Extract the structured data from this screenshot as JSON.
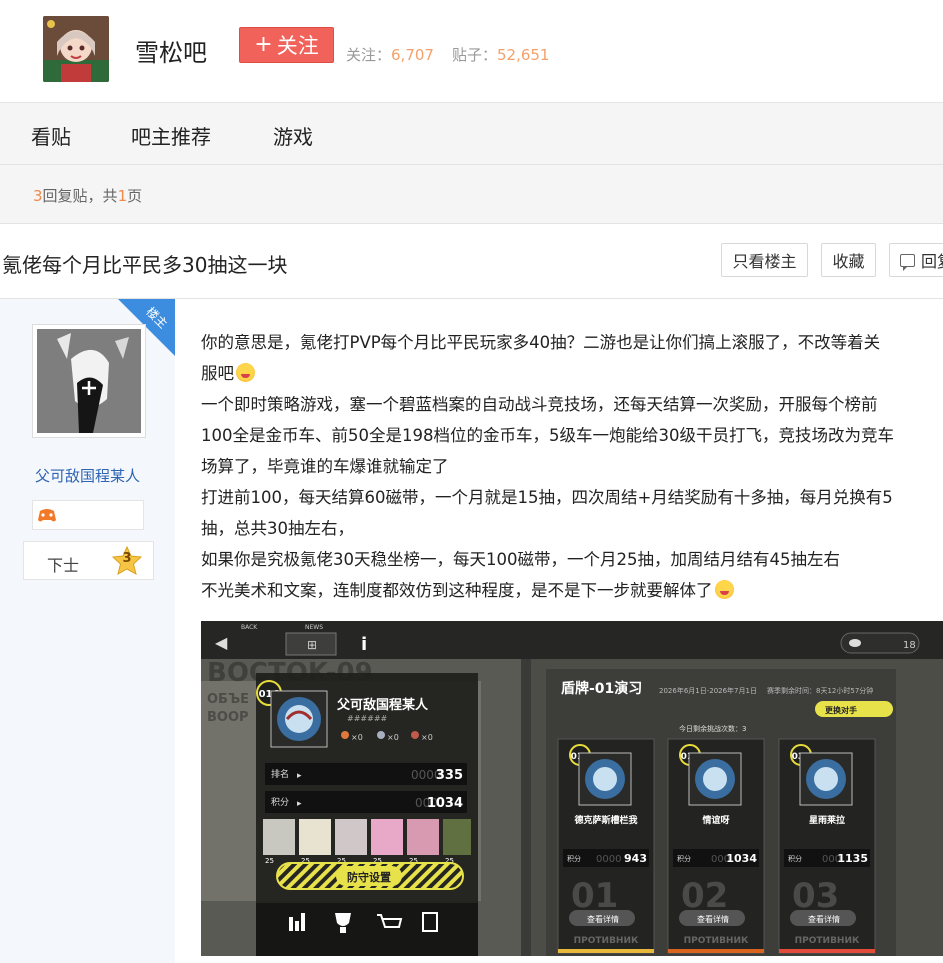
{
  "header": {
    "forum_name": "雪松吧",
    "follow_label": "关注",
    "stats": [
      {
        "label": "关注：",
        "value": "6,707"
      },
      {
        "label": "贴子：",
        "value": "52,651"
      }
    ]
  },
  "nav": {
    "tabs": [
      {
        "label": "看贴"
      },
      {
        "label": "吧主推荐"
      },
      {
        "label": "游戏"
      }
    ]
  },
  "reply_info": {
    "count": "3",
    "mid": "回复贴，共",
    "pages": "1",
    "suffix": "页"
  },
  "thread": {
    "title": "氪佬每个月比平民多30抽这一块",
    "buttons": {
      "only_op": "只看楼主",
      "collect": "收藏",
      "reply": "回复"
    }
  },
  "post": {
    "badge": "楼主",
    "author": {
      "name": "父可敌国程某人",
      "level_title": "下士",
      "level_num": "3"
    },
    "lines": [
      "你的意思是，氪佬打PVP每个月比平民玩家多40抽？二游也是让你们搞上滚服了，不改等着关",
      "服吧",
      "一个即时策略游戏，塞一个碧蓝档案的自动战斗竞技场，还每天结算一次奖励，开服每个榜前",
      "100全是金币车、前50全是198档位的金币车，5级车一炮能给30级干员打飞，竞技场改为竞车",
      "场算了，毕竟谁的车爆谁就输定了",
      "打进前100，每天结算60磁带，一个月就是15抽，四次周结+月结奖励有十多抽，每月兑换有5",
      "抽，总共30抽左右，",
      "如果你是究极氪佬30天稳坐榜一，每天100磁带，一个月25抽，加周结月结有45抽左右",
      "不光美术和文案，连制度都效仿到这种程度，是不是下一步就要解体了"
    ]
  },
  "game": {
    "back_label": "BACK",
    "news_label": "NEWS",
    "counter": "18",
    "bg_text1": "BOCTOK-09",
    "bg_text2": "ОБЪЕ",
    "bg_text3": "BOOP",
    "player": {
      "rank_badge": "016",
      "name": "父可敌国程某人",
      "sub": "######",
      "item_counts": [
        "×0",
        "×0",
        "×0"
      ],
      "rank_label": "排名",
      "rank_value": "335",
      "rank_ghost": "0000",
      "score_label": "积分",
      "score_value": "1034",
      "score_ghost": "000",
      "unit_levels": [
        "25",
        "25",
        "25",
        "25",
        "25",
        "25"
      ],
      "defense_label": "防守设置"
    },
    "exercise": {
      "title": "盾牌-01演习",
      "period": "2026年6月1日-2026年7月1日",
      "remaining": "赛季剩余时间：8天12小时57分钟",
      "change_btn": "更换对手",
      "challenges": "今日剩余挑战次数：3",
      "opponents": [
        {
          "rank": "019",
          "name": "德克萨斯槽栏我",
          "score_label": "积分",
          "score": "943",
          "ghost": "0000",
          "big": "01",
          "detail": "查看详情",
          "footer": "ПРОТИВНИК"
        },
        {
          "rank": "018",
          "name": "情谊呀",
          "score_label": "积分",
          "score": "1034",
          "ghost": "000",
          "big": "02",
          "detail": "查看详情",
          "footer": "ПРОТИВНИК"
        },
        {
          "rank": "031",
          "name": "星雨莱拉",
          "score_label": "积分",
          "score": "1135",
          "ghost": "000",
          "big": "03",
          "detail": "查看详情",
          "footer": "ПРОТИВНИК"
        }
      ]
    },
    "footer_colors": [
      "#e8b83a",
      "#d8641e",
      "#e24a3a"
    ]
  }
}
